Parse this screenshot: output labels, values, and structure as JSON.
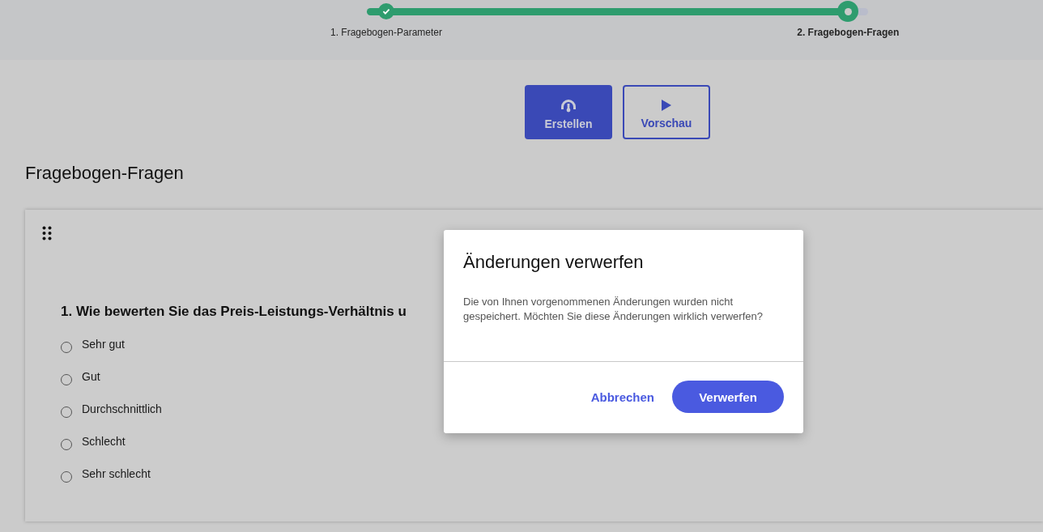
{
  "stepper": {
    "level": 0.96,
    "steps": [
      {
        "label": "1. Fragebogen-Parameter",
        "kind": "done"
      },
      {
        "label": "2. Fragebogen-Fragen",
        "kind": "current"
      }
    ]
  },
  "actions": [
    {
      "kind": "primary",
      "label": "Erstellen"
    },
    {
      "kind": "outline",
      "label": "Vorschau"
    }
  ],
  "section_title": "Fragebogen-Fragen",
  "question": {
    "text": "1. Wie bewerten Sie das Preis-Leistungs-Verhältnis u",
    "options": [
      {
        "label": "Sehr gut",
        "selected": false
      },
      {
        "label": "Gut",
        "selected": false
      },
      {
        "label": "Durchschnittlich",
        "selected": false
      },
      {
        "label": "Schlecht",
        "selected": false
      },
      {
        "label": "Sehr schlecht",
        "selected": false
      }
    ]
  },
  "dialog": {
    "title": "Änderungen verwerfen",
    "message": "Die von Ihnen vorgenommenen Änderungen wurden nicht gespeichert. Möchten Sie diese Änderungen wirklich verwerfen?",
    "buttons": [
      {
        "kind": "text",
        "label": "Abbrechen"
      },
      {
        "kind": "filled",
        "label": "Verwerfen"
      }
    ]
  }
}
